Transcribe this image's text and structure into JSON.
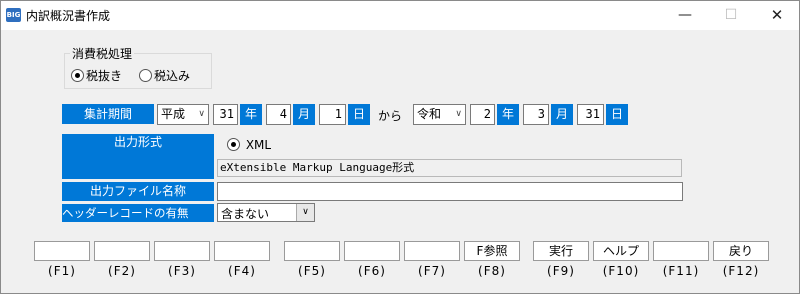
{
  "window": {
    "app_icon": "BIG",
    "title": "内訳概況書作成",
    "min": "—",
    "max": "☐",
    "close": "✕"
  },
  "tax": {
    "label": "消費税処理",
    "option1": "税抜き",
    "option2": "税込み",
    "selected": "税抜き"
  },
  "period": {
    "label": "集計期間",
    "start_era": "平成",
    "start_year": "31",
    "start_month": "4",
    "start_day": "1",
    "to_text": "から",
    "end_era": "令和",
    "end_year": "2",
    "end_month": "3",
    "end_day": "31",
    "year_unit": "年",
    "month_unit": "月",
    "day_unit": "日"
  },
  "output_format": {
    "label": "出力形式",
    "option": "XML",
    "description": "eXtensible Markup Language形式"
  },
  "output_file": {
    "label": "出力ファイル名称",
    "value": ""
  },
  "header_record": {
    "label": "ヘッダーレコードの有無",
    "value": "含まない"
  },
  "fkeys": [
    {
      "label": "",
      "key": "(F1)"
    },
    {
      "label": "",
      "key": "(F2)"
    },
    {
      "label": "",
      "key": "(F3)"
    },
    {
      "label": "",
      "key": "(F4)"
    },
    {
      "label": "",
      "key": "(F5)"
    },
    {
      "label": "",
      "key": "(F6)"
    },
    {
      "label": "",
      "key": "(F7)"
    },
    {
      "label": "F参照",
      "key": "(F8)"
    },
    {
      "label": "実行",
      "key": "(F9)"
    },
    {
      "label": "ヘルプ",
      "key": "(F10)"
    },
    {
      "label": "",
      "key": "(F11)"
    },
    {
      "label": "戻り",
      "key": "(F12)"
    }
  ]
}
